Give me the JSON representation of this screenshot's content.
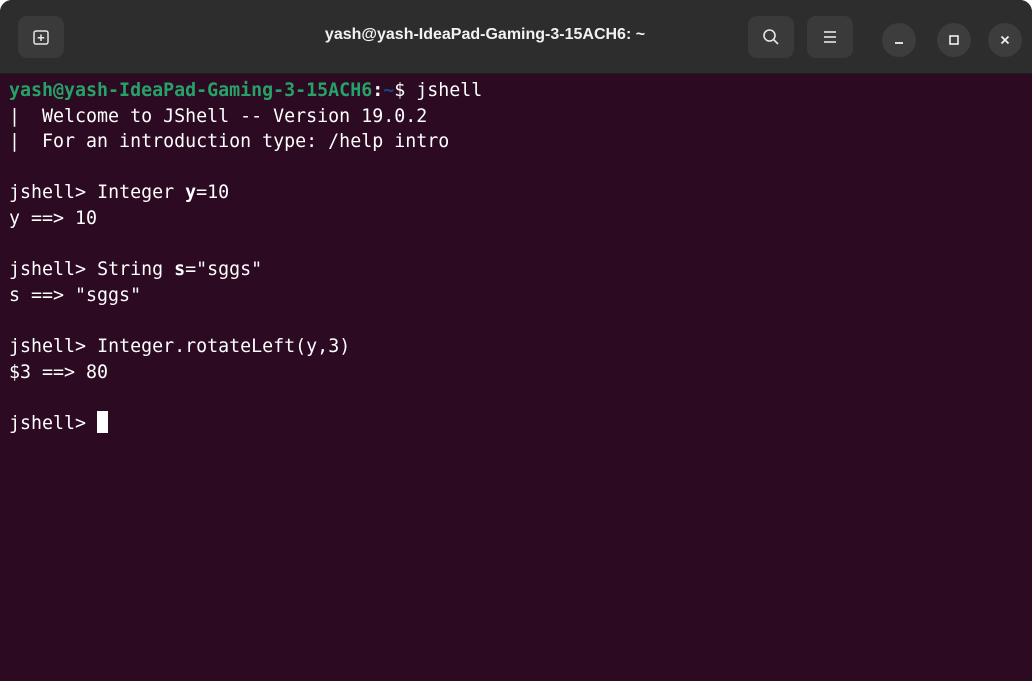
{
  "window": {
    "title": "yash@yash-IdeaPad-Gaming-3-15ACH6: ~"
  },
  "terminal": {
    "prompt_user": "yash@yash-IdeaPad-Gaming-3-15ACH6",
    "prompt_colon": ":",
    "prompt_path": "~",
    "prompt_suffix": "$ jshell",
    "welcome_line": "|  Welcome to JShell -- Version 19.0.2",
    "intro_line": "|  For an introduction type: /help intro",
    "jshell_prompt": "jshell> ",
    "cmd1_type": "Integer ",
    "cmd1_var": "y",
    "cmd1_rest": "=10",
    "out1": "y ==> 10",
    "cmd2_type": "String ",
    "cmd2_var": "s",
    "cmd2_rest": "=\"sggs\"",
    "out2": "s ==> \"sggs\"",
    "cmd3": "Integer.rotateLeft(y,3)",
    "out3": "$3 ==> 80"
  },
  "colors": {
    "terminal_bg": "#2c0a22",
    "titlebar_bg": "#2d2d2d",
    "prompt_user": "#26a269",
    "prompt_path": "#12488b"
  },
  "icons": {
    "new_tab": "new-tab-icon",
    "search": "search-icon",
    "menu": "hamburger-menu-icon",
    "minimize": "minimize-icon",
    "maximize": "maximize-icon",
    "close": "close-icon"
  }
}
